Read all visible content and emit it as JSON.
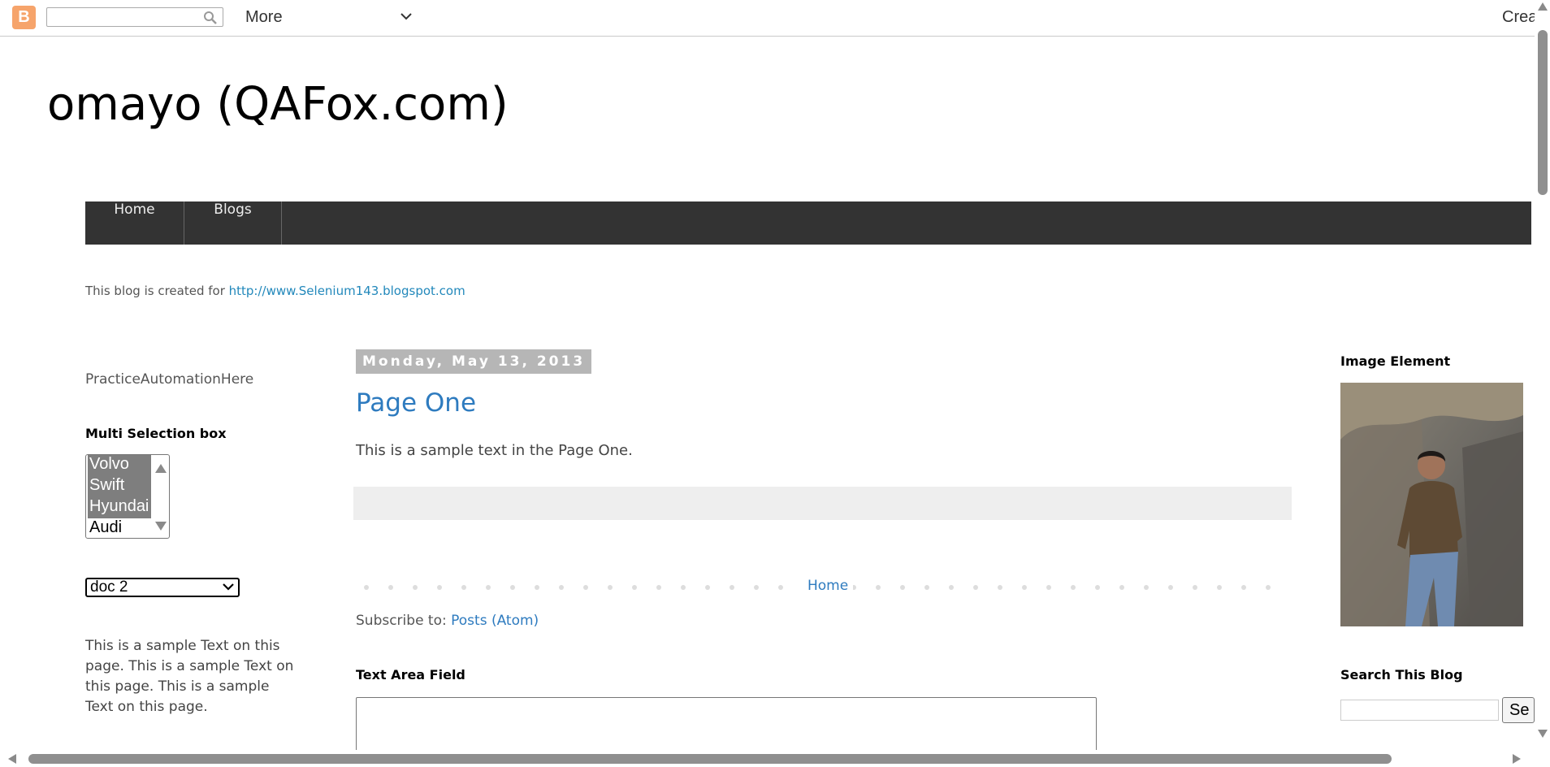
{
  "navbar": {
    "logo_icon": "blogger-logo-icon",
    "logo_letter": "B",
    "search_placeholder": "",
    "more_label": "More",
    "create_label": "Crea"
  },
  "header": {
    "title": "omayo (QAFox.com)",
    "tabs": [
      {
        "label": "Home"
      },
      {
        "label": "Blogs"
      }
    ],
    "description_prefix": "This blog is created for ",
    "description_link": "http://www.Selenium143.blogspot.com"
  },
  "left_sidebar": {
    "practice_text": "PracticeAutomationHere",
    "multi_title": "Multi Selection box",
    "multi_options": [
      {
        "label": "Volvo",
        "selected": true
      },
      {
        "label": "Swift",
        "selected": true
      },
      {
        "label": "Hyundai",
        "selected": true
      },
      {
        "label": "Audi",
        "selected": false
      }
    ],
    "dropdown_value": "doc 2",
    "sample_text": "This is a sample Text on this page. This is a sample Text on this page. This is a sample Text on this page."
  },
  "main": {
    "date_header": "Monday, May 13, 2013",
    "post_title": "Page One",
    "post_body": "This is a sample text in the Page One.",
    "home_link": "Home",
    "subscribe_label": "Subscribe to: ",
    "subscribe_link": "Posts (Atom)",
    "textarea_title": "Text Area Field",
    "textarea_value": ""
  },
  "right_sidebar": {
    "image_title": "Image Element",
    "search_title": "Search This Blog",
    "search_value": "",
    "search_button": "Se"
  },
  "colors": {
    "link": "#2e7bbf",
    "tabs_bg": "#333333",
    "date_bg": "#b6b6b6",
    "blogger_orange": "#f6a46b"
  }
}
